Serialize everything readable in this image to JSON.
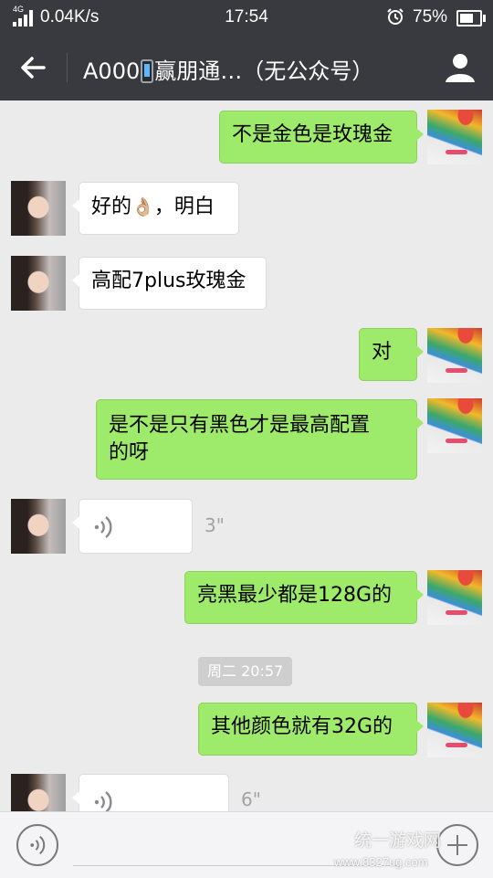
{
  "status_bar": {
    "network": "4G",
    "speed": "0.04K/s",
    "time": "17:54",
    "battery": "75%"
  },
  "nav": {
    "title_prefix": "A000",
    "title_suffix": "赢朋通…（无公众号）"
  },
  "messages": [
    {
      "sender": "me",
      "text": "不是金色是玫瑰金"
    },
    {
      "sender": "them",
      "text_before": "好的",
      "emoji": "👌🏼",
      "text_after": "，明白"
    },
    {
      "sender": "them",
      "text": "高配7plus玫瑰金"
    },
    {
      "sender": "me",
      "text": "对"
    },
    {
      "sender": "me",
      "text_line1": "是不是只有黑色才是最高配置",
      "text_line2": "的呀"
    },
    {
      "sender": "them",
      "type": "voice",
      "duration": "3\""
    },
    {
      "sender": "me",
      "text": "亮黑最少都是128G的"
    },
    {
      "sender": "system",
      "type": "time",
      "text": "周二 20:57"
    },
    {
      "sender": "me",
      "text": "其他颜色就有32G的"
    },
    {
      "sender": "them",
      "type": "voice",
      "duration": "6\""
    }
  ],
  "watermark": {
    "text": "统一游戏网",
    "url": "www.8327ug.com"
  },
  "colors": {
    "header_bg": "#393a3f",
    "chat_bg": "#ebebeb",
    "my_bubble": "#9eea6a",
    "their_bubble": "#ffffff"
  },
  "icons": [
    "back-arrow-icon",
    "person-icon",
    "voice-wave-icon",
    "plus-icon",
    "alarm-icon",
    "battery-icon",
    "signal-icon"
  ]
}
